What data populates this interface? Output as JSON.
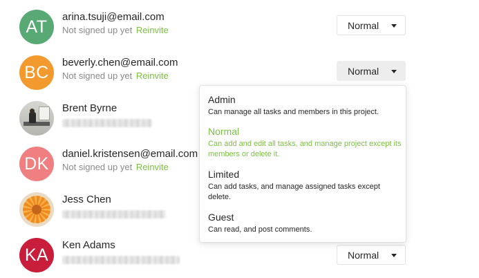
{
  "members": [
    {
      "initials": "AT",
      "avatar_color": "#58a973",
      "name": "arina.tsuji@email.com",
      "status": "Not signed up yet",
      "action": "Reinvite",
      "role": "Normal"
    },
    {
      "initials": "BC",
      "avatar_color": "#f39a2e",
      "name": "beverly.chen@email.com",
      "status": "Not signed up yet",
      "action": "Reinvite",
      "role": "Normal"
    },
    {
      "avatar_icon": "office-photo",
      "name": "Brent Byrne"
    },
    {
      "initials": "DK",
      "avatar_color": "#ef7f80",
      "name": "daniel.kristensen@email.com",
      "status": "Not signed up yet",
      "action": "Reinvite"
    },
    {
      "avatar_icon": "flower-photo",
      "name": "Jess Chen"
    },
    {
      "initials": "KA",
      "avatar_color": "#c81e3c",
      "name": "Ken Adams",
      "role": "Normal"
    }
  ],
  "role_menu": {
    "selected": "Normal",
    "accent_color": "#7cc142",
    "options": [
      {
        "title": "Admin",
        "description": "Can manage all tasks and members in this project."
      },
      {
        "title": "Normal",
        "description": "Can add and edit all tasks, and manage project except its members or delete it."
      },
      {
        "title": "Limited",
        "description": "Can add tasks, and manage assigned tasks except delete."
      },
      {
        "title": "Guest",
        "description": "Can read, and post comments."
      }
    ]
  }
}
